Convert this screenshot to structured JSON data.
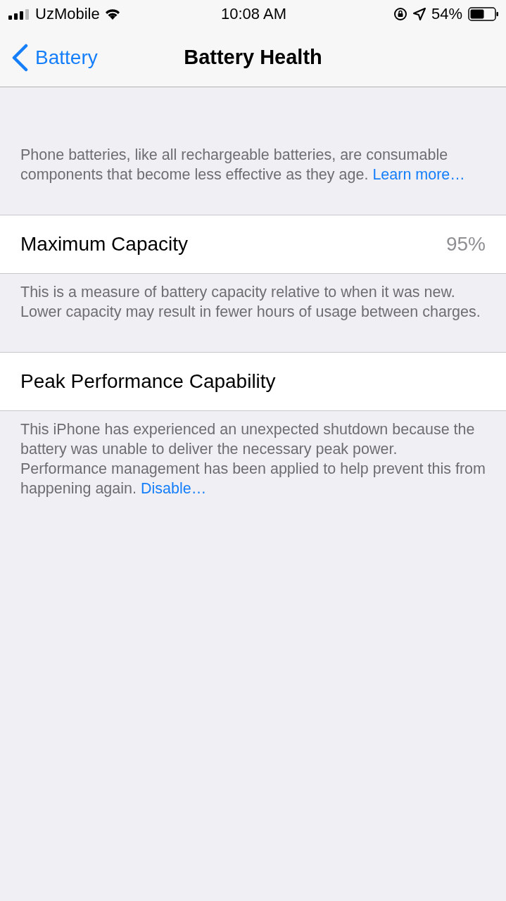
{
  "status_bar": {
    "carrier": "UzMobile",
    "time": "10:08 AM",
    "battery_percent": "54%"
  },
  "nav": {
    "back_label": "Battery",
    "title": "Battery Health"
  },
  "sections": [
    {
      "kind": "note",
      "text": "Phone batteries, like all rechargeable batteries, are consumable components that become less effective as they age. ",
      "link": "Learn more…"
    },
    {
      "kind": "cell",
      "label": "Maximum Capacity",
      "value": "95%"
    },
    {
      "kind": "note",
      "text": "This is a measure of battery capacity relative to when it was new. Lower capacity may result in fewer hours of usage between charges."
    },
    {
      "kind": "cell",
      "label": "Peak Performance Capability"
    },
    {
      "kind": "note",
      "text": "This iPhone has experienced an unexpected shutdown because the battery was unable to deliver the necessary peak power. Performance management has been applied to help prevent this from happening again. ",
      "link": "Disable…"
    }
  ]
}
